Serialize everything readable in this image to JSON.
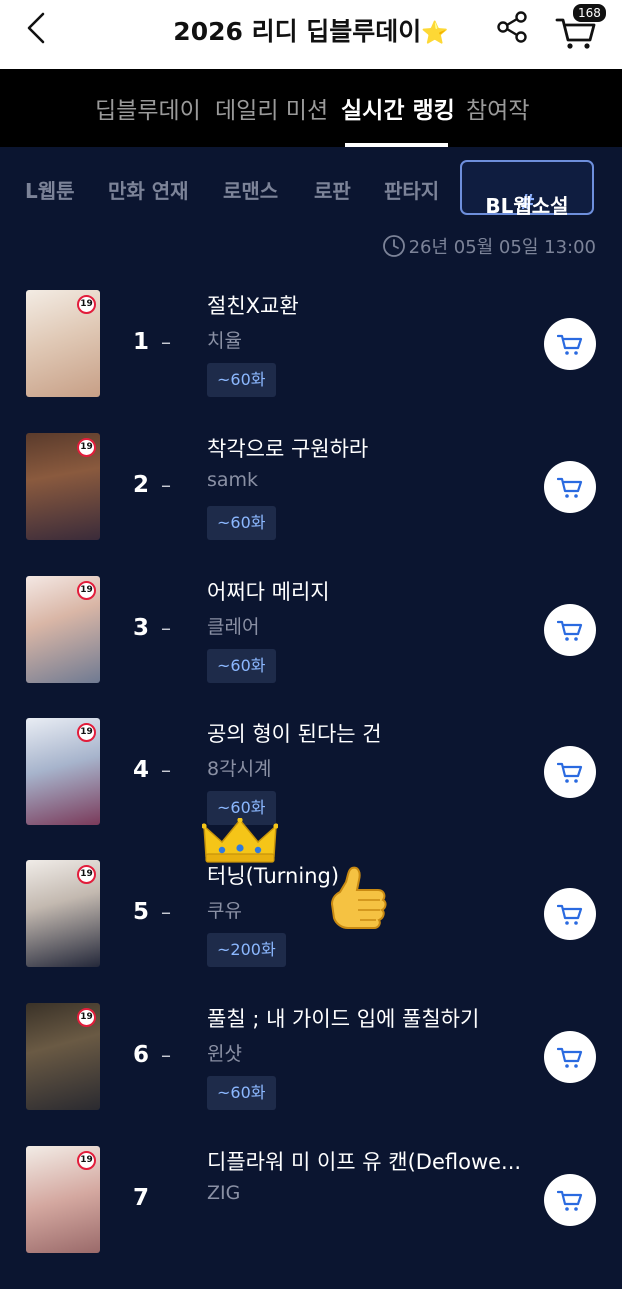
{
  "header": {
    "title": "2026 리디 딥블루데이",
    "title_emoji": "⭐",
    "cart_count": "168"
  },
  "tabs": [
    {
      "label": "딥블루데이",
      "active": false
    },
    {
      "label": "데일리 미션",
      "active": false
    },
    {
      "label": "실시간 랭킹",
      "active": true
    },
    {
      "label": "참여작",
      "active": false
    }
  ],
  "genres": [
    {
      "label": "L웹툰"
    },
    {
      "label": "만화 연재"
    },
    {
      "label": "로맨스"
    },
    {
      "label": "로판"
    },
    {
      "label": "판타지"
    }
  ],
  "active_genre": {
    "hash": "#",
    "label": "BL웹소설"
  },
  "timestamp": "26년 05월 05일 13:00",
  "ranking": [
    {
      "rank": "1",
      "change": "–",
      "title": "절친X교환",
      "author": "치율",
      "episodes": "~60화",
      "age": "19"
    },
    {
      "rank": "2",
      "change": "–",
      "title": "착각으로 구원하라",
      "author": "samk",
      "episodes": "~60화",
      "age": "19"
    },
    {
      "rank": "3",
      "change": "–",
      "title": "어쩌다 메리지",
      "author": "클레어",
      "episodes": "~60화",
      "age": "19"
    },
    {
      "rank": "4",
      "change": "–",
      "title": "공의 형이 된다는 건",
      "author": "8각시계",
      "episodes": "~60화",
      "age": "19"
    },
    {
      "rank": "5",
      "change": "–",
      "title": "터닝(Turning)",
      "author": "쿠유",
      "episodes": "~200화",
      "age": "19"
    },
    {
      "rank": "6",
      "change": "–",
      "title": "풀칠 ; 내 가이드 입에 풀칠하기",
      "author": "윈샷",
      "episodes": "~60화",
      "age": "19"
    },
    {
      "rank": "7",
      "change": "–",
      "title": "디플라워 미 이프 유 캔(Deflowe...",
      "author": "ZIG",
      "episodes": "",
      "age": "19"
    }
  ],
  "colors": {
    "background": "#0b1530",
    "accent_blue": "#8cb8ff",
    "chip_bg": "#1e2b4a",
    "age_badge_border": "#e21d3b"
  },
  "icons": {
    "back": "chevron-left-icon",
    "share": "share-icon",
    "cart": "cart-icon",
    "clock": "clock-icon",
    "crown": "crown-icon",
    "thumb": "thumbs-up-icon"
  }
}
